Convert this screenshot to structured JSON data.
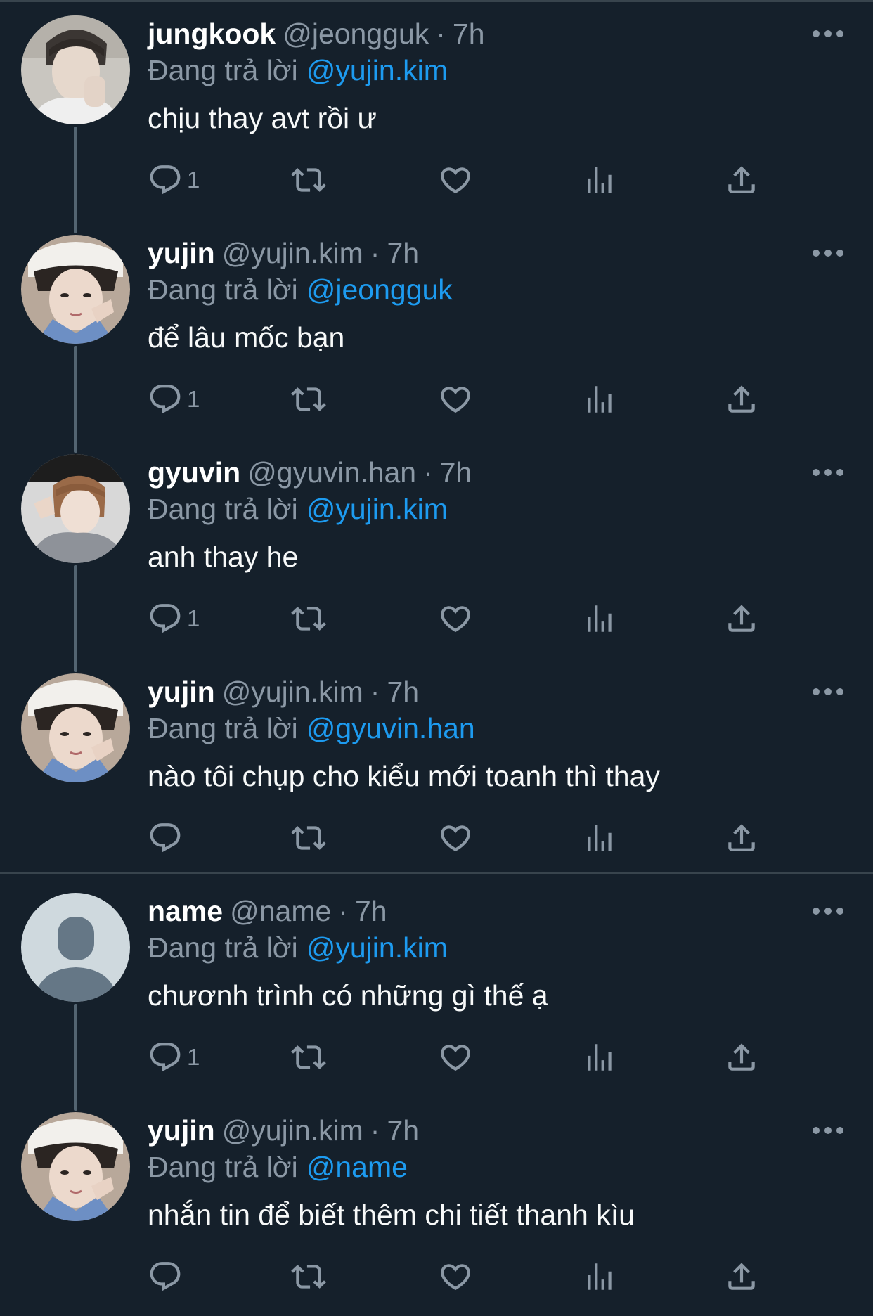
{
  "replying_label": "Đang trả lời",
  "colors": {
    "background": "#15202b",
    "secondary_text": "#8b98a5",
    "link": "#1d9bf0",
    "divider": "#38444d"
  },
  "tweets": [
    {
      "display_name": "jungkook",
      "handle": "@jeongguk",
      "separator": "·",
      "time": "7h",
      "replying_to": "@yujin.kim",
      "text": "chịu thay avt rồi ư",
      "reply_count": "1",
      "avatar": "photo-jungkook"
    },
    {
      "display_name": "yujin",
      "handle": "@yujin.kim",
      "separator": "·",
      "time": "7h",
      "replying_to": "@jeongguk",
      "text": "để lâu mốc bạn",
      "reply_count": "1",
      "avatar": "photo-yujin"
    },
    {
      "display_name": "gyuvin",
      "handle": "@gyuvin.han",
      "separator": "·",
      "time": "7h",
      "replying_to": "@yujin.kim",
      "text": "anh thay he",
      "reply_count": "1",
      "avatar": "photo-gyuvin"
    },
    {
      "display_name": "yujin",
      "handle": "@yujin.kim",
      "separator": "·",
      "time": "7h",
      "replying_to": "@gyuvin.han",
      "text": "nào tôi chụp cho kiểu mới toanh thì thay",
      "reply_count": "",
      "avatar": "photo-yujin"
    },
    {
      "display_name": "name",
      "handle": "@name",
      "separator": "·",
      "time": "7h",
      "replying_to": "@yujin.kim",
      "text": "chươnh trình có những gì thế ạ",
      "reply_count": "1",
      "avatar": "default-avatar"
    },
    {
      "display_name": "yujin",
      "handle": "@yujin.kim",
      "separator": "·",
      "time": "7h",
      "replying_to": "@name",
      "text": "nhắn tin để biết thêm chi tiết thanh kìu",
      "reply_count": "",
      "avatar": "photo-yujin"
    }
  ]
}
